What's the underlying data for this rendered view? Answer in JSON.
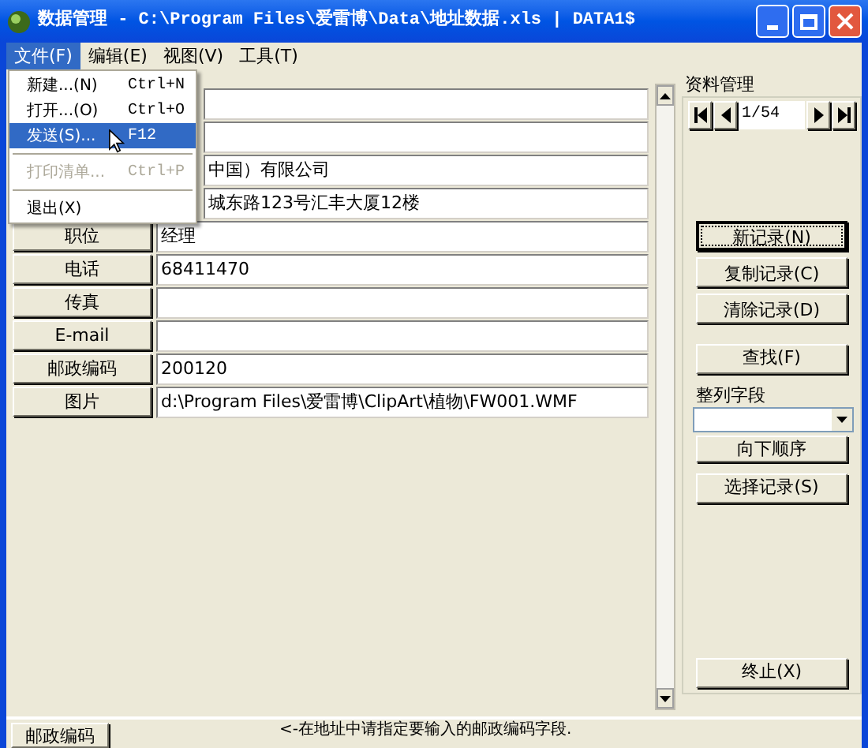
{
  "window": {
    "title": "数据管理 - C:\\Program Files\\爱雷博\\Data\\地址数据.xls | DATA1$"
  },
  "menu_bar": [
    {
      "label": "文件(F)",
      "selected": true
    },
    {
      "label": "编辑(E)",
      "selected": false
    },
    {
      "label": "视图(V)",
      "selected": false
    },
    {
      "label": "工具(T)",
      "selected": false
    }
  ],
  "file_menu": [
    {
      "kind": "item",
      "label": "新建...(N)",
      "shortcut": "Ctrl+N",
      "selected": false,
      "disabled": false
    },
    {
      "kind": "item",
      "label": "打开...(O)",
      "shortcut": "Ctrl+O",
      "selected": false,
      "disabled": false
    },
    {
      "kind": "item",
      "label": "发送(S)...",
      "shortcut": "F12",
      "selected": true,
      "disabled": false
    },
    {
      "kind": "separator"
    },
    {
      "kind": "item",
      "label": "打印清单...",
      "shortcut": "Ctrl+P",
      "selected": false,
      "disabled": true
    },
    {
      "kind": "separator"
    },
    {
      "kind": "item",
      "label": "退出(X)",
      "selected": false,
      "disabled": false
    }
  ],
  "fields": [
    {
      "kind": "covered"
    },
    {
      "kind": "covered"
    },
    {
      "kind": "covered",
      "value": "中国）有限公司"
    },
    {
      "kind": "covered",
      "value": "城东路123号汇丰大厦12楼"
    },
    {
      "kind": "labeled",
      "label": "职位",
      "value": "经理"
    },
    {
      "kind": "labeled",
      "label": "电话",
      "value": "68411470"
    },
    {
      "kind": "labeled",
      "label": "传真"
    },
    {
      "kind": "labeled",
      "label": "E-mail"
    },
    {
      "kind": "labeled",
      "label": "邮政编码",
      "value": "200120"
    },
    {
      "kind": "labeled",
      "label": "图片",
      "value": "d:\\Program Files\\爱雷博\\ClipArt\\植物\\FW001.WMF"
    }
  ],
  "panel": {
    "title": "资料管理",
    "record": "1/54",
    "buttons": [
      {
        "label": "新记录(N)",
        "focused": true
      },
      {
        "label": "复制记录(C)",
        "focused": false
      },
      {
        "label": "清除记录(D)",
        "focused": false
      }
    ],
    "find_button": "查找(F)",
    "sort_label": "整列字段",
    "order_button": "向下顺序",
    "select_button": "选择记录(S)",
    "exit_button": "终止(X)"
  },
  "bottom": {
    "button": "邮政编码",
    "hint": "<-在地址中请指定要输入的邮政编码字段."
  }
}
